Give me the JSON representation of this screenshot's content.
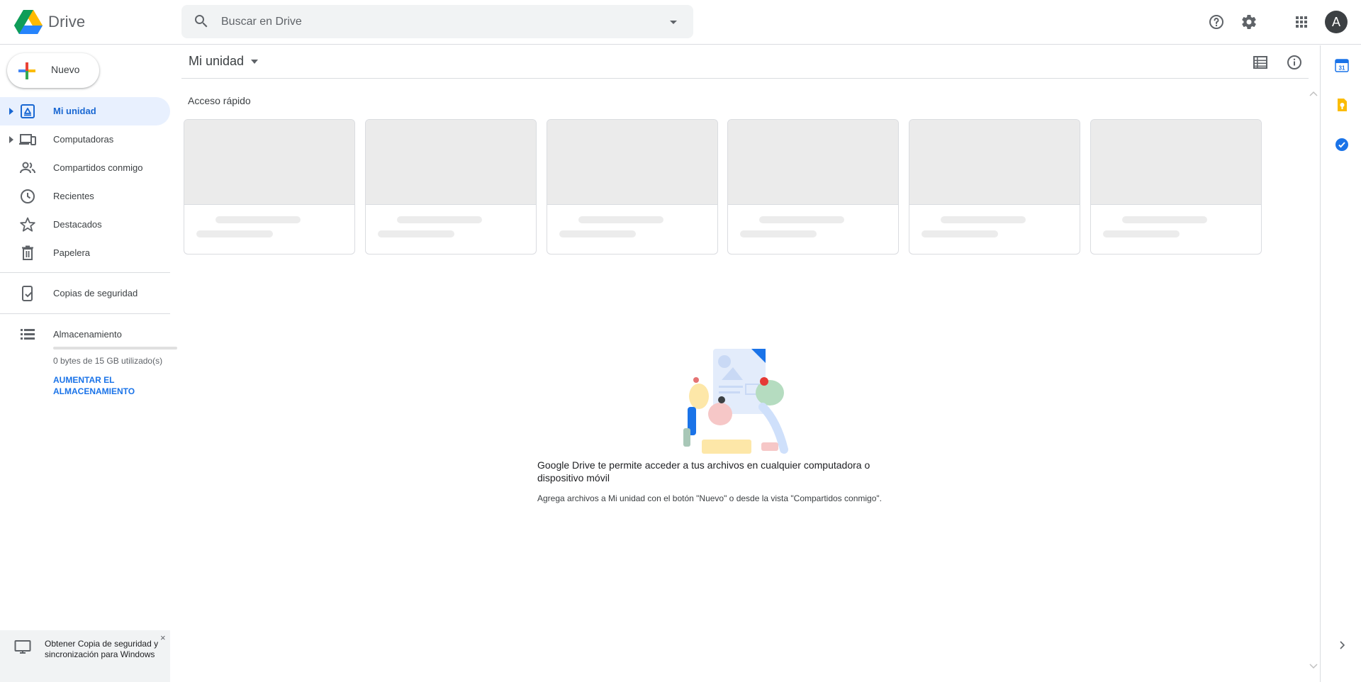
{
  "app": {
    "name": "Drive"
  },
  "search": {
    "placeholder": "Buscar en Drive"
  },
  "sidebar": {
    "new_label": "Nuevo",
    "items": [
      {
        "label": "Mi unidad",
        "icon": "my-drive-icon"
      },
      {
        "label": "Computadoras",
        "icon": "computers-icon"
      },
      {
        "label": "Compartidos conmigo",
        "icon": "shared-with-me-icon"
      },
      {
        "label": "Recientes",
        "icon": "recent-icon"
      },
      {
        "label": "Destacados",
        "icon": "starred-icon"
      },
      {
        "label": "Papelera",
        "icon": "trash-icon"
      }
    ],
    "backups_label": "Copias de seguridad",
    "storage_label": "Almacenamiento",
    "storage_used": "0 bytes de 15 GB utilizado(s)",
    "storage_used_fraction": 0,
    "upgrade_label": "AUMENTAR EL ALMACENAMIENTO",
    "promo_text": "Obtener Copia de seguridad y sincronización para Windows",
    "promo_close": "×"
  },
  "main": {
    "breadcrumb": "Mi unidad",
    "quick_access_title": "Acceso rápido",
    "quick_access_cards": 6,
    "empty_title": "Google Drive te permite acceder a tus archivos en cualquier computadora o dispositivo móvil",
    "empty_subtitle": "Agrega archivos a Mi unidad con el botón \"Nuevo\" o desde la vista \"Compartidos conmigo\"."
  },
  "account": {
    "initial": "A"
  },
  "colors": {
    "accent": "#1a73e8",
    "active_bg": "#e8f0fe",
    "active_text": "#1967d2",
    "avatar_bg": "#3c4043"
  }
}
